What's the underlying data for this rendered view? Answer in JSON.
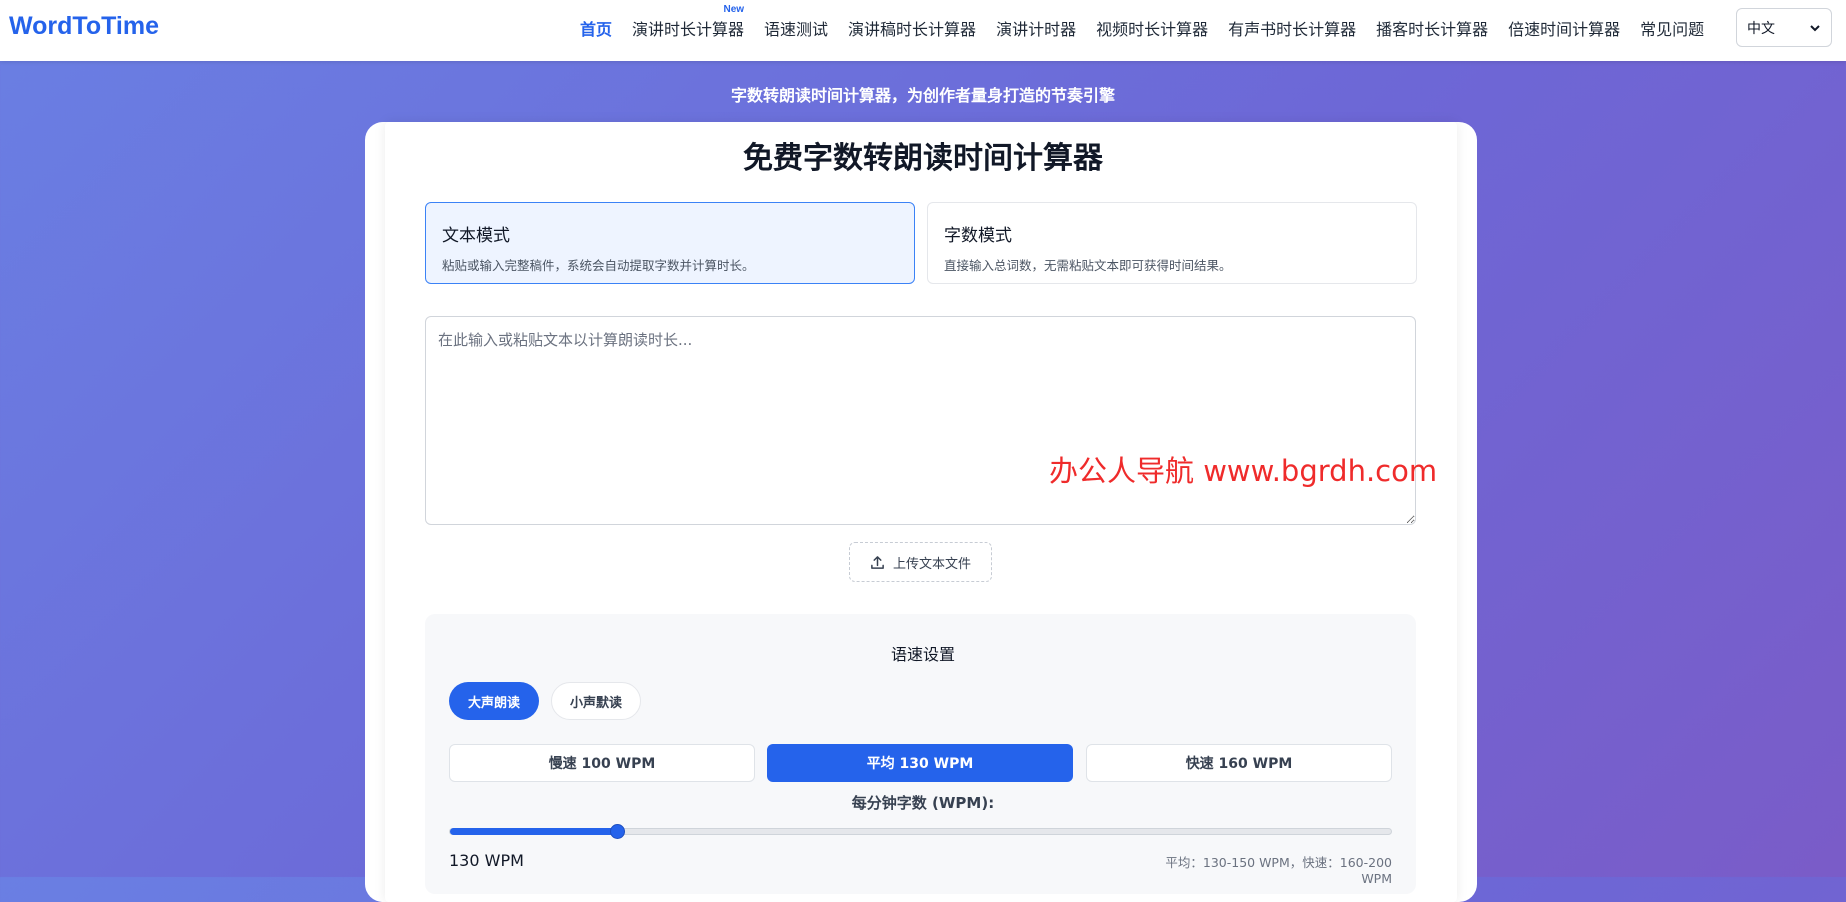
{
  "header": {
    "logo": "WordToTime",
    "nav": [
      {
        "label": "首页",
        "active": true,
        "badge": ""
      },
      {
        "label": "演讲时长计算器",
        "active": false,
        "badge": "New"
      },
      {
        "label": "语速测试",
        "active": false,
        "badge": ""
      },
      {
        "label": "演讲稿时长计算器",
        "active": false,
        "badge": ""
      },
      {
        "label": "演讲计时器",
        "active": false,
        "badge": ""
      },
      {
        "label": "视频时长计算器",
        "active": false,
        "badge": ""
      },
      {
        "label": "有声书时长计算器",
        "active": false,
        "badge": ""
      },
      {
        "label": "播客时长计算器",
        "active": false,
        "badge": ""
      },
      {
        "label": "倍速时间计算器",
        "active": false,
        "badge": ""
      },
      {
        "label": "常见问题",
        "active": false,
        "badge": ""
      }
    ],
    "language": "中文"
  },
  "hero": {
    "tagline": "字数转朗读时间计算器，为创作者量身打造的节奏引擎"
  },
  "main": {
    "title": "免费字数转朗读时间计算器",
    "modes": [
      {
        "title": "文本模式",
        "desc": "粘贴或输入完整稿件，系统会自动提取字数并计算时长。",
        "selected": true
      },
      {
        "title": "字数模式",
        "desc": "直接输入总词数，无需粘贴文本即可获得时间结果。",
        "selected": false
      }
    ],
    "textarea_placeholder": "在此输入或粘贴文本以计算朗读时长...",
    "watermark": "办公人导航  www.bgrdh.com",
    "upload_label": "上传文本文件"
  },
  "speed": {
    "title": "语速设置",
    "reading_modes": [
      {
        "label": "大声朗读",
        "active": true
      },
      {
        "label": "小声默读",
        "active": false
      }
    ],
    "presets": [
      {
        "label": "慢速 100 WPM",
        "active": false
      },
      {
        "label": "平均 130 WPM",
        "active": true
      },
      {
        "label": "快速 160 WPM",
        "active": false
      }
    ],
    "wpm_label": "每分钟字数 (WPM):",
    "slider": {
      "min": 50,
      "max": 500,
      "value": 130
    },
    "value_text": "130 WPM",
    "hint": "平均：130-150 WPM，快速：160-200 WPM"
  },
  "colors": {
    "accent": "#2563eb",
    "watermark": "#ef2b2b"
  }
}
